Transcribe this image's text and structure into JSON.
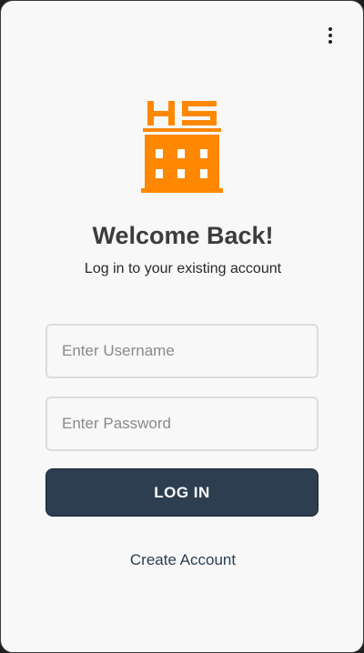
{
  "header": {
    "menu_icon": "more-vertical-icon"
  },
  "brand": {
    "logo_text": "HS",
    "logo_icon": "building-icon",
    "accent_color": "#FF8800"
  },
  "login": {
    "title": "Welcome Back!",
    "subtitle": "Log in to your existing account",
    "username_placeholder": "Enter Username",
    "username_value": "",
    "password_placeholder": "Enter Password",
    "password_value": "",
    "login_button_label": "LOG IN",
    "create_account_label": "Create Account",
    "button_color": "#2D3E50"
  }
}
